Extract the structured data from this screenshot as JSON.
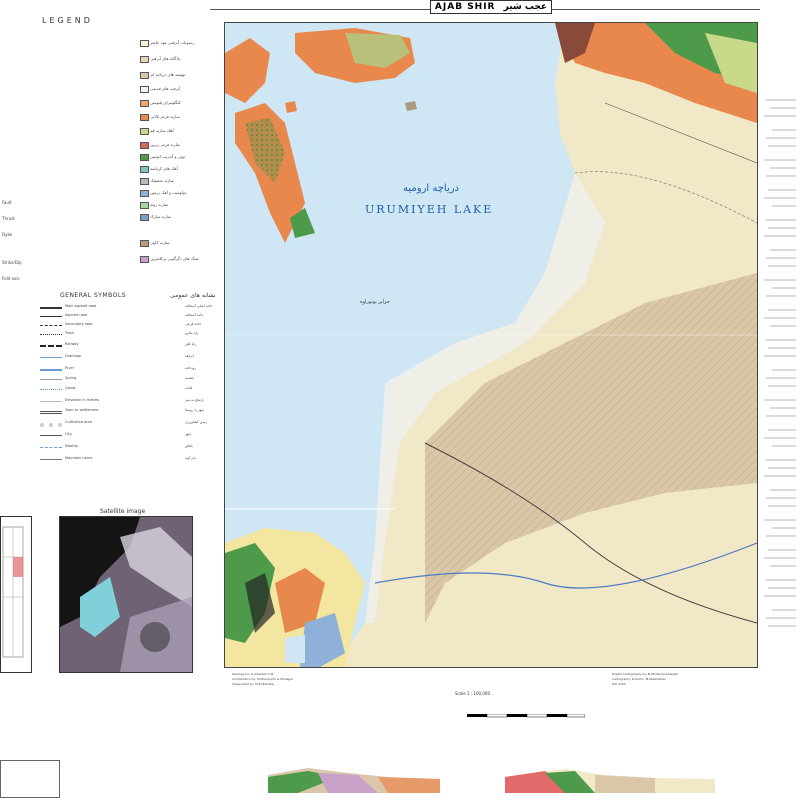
{
  "header": {
    "title": "AJAB SHIR",
    "title_fa": "عجب شیر"
  },
  "legend": {
    "title": "LEGEND",
    "items": [
      "رسوبات آبرفتی عهد حاضر",
      "پادگانه های آبرفتی",
      "نهشته های دریاچه ای",
      "آبرفت های قدیمی",
      "کنگلومرای پلیوسن",
      "سازند قرمز بالایی",
      "آهک سازند قم",
      "سازند قرمز زیرین",
      "توف و آندزیت ائوسن",
      "آهک های کرتاسه",
      "سازند شمشک",
      "دولومیت و آهک پرمین",
      "سازند روته",
      "سازند مبارک",
      "سازند لالون",
      "سنگ های دگرگونی پرکامبرین"
    ],
    "left_items": [
      "Fault",
      "Thrust",
      "Dyke",
      "Strike/Dip",
      "Fold axis"
    ]
  },
  "general_symbols": {
    "title": "GENERAL SYMBOLS",
    "title_fa": "نشانه های عمومی",
    "rows": [
      {
        "en": "Main asphalt road",
        "fa": "جاده اصلی آسفالته"
      },
      {
        "en": "Asphalt road",
        "fa": "جاده آسفالته"
      },
      {
        "en": "Secondary road",
        "fa": "جاده فرعی"
      },
      {
        "en": "Track",
        "fa": "راه مالرو"
      },
      {
        "en": "Railway",
        "fa": "راه آهن"
      },
      {
        "en": "Drainage",
        "fa": "آبراهه"
      },
      {
        "en": "River",
        "fa": "رودخانه"
      },
      {
        "en": "Spring",
        "fa": "چشمه"
      },
      {
        "en": "Qanat",
        "fa": "قنات"
      },
      {
        "en": "Elevation in metres",
        "fa": "ارتفاع به متر"
      },
      {
        "en": "Town or settlement",
        "fa": "شهر یا روستا"
      },
      {
        "en": "Cultivated area",
        "fa": "زمین کشاورزی"
      },
      {
        "en": "City",
        "fa": "شهر"
      },
      {
        "en": "Swamp",
        "fa": "باتلاق"
      },
      {
        "en": "Mountain name",
        "fa": "نام کوه"
      }
    ]
  },
  "map": {
    "lake_name_en": "URUMIYEH LAKE",
    "lake_name_fa": "دریاچه ارومیه",
    "peninsula_fa": "جزایر بوتوراوه",
    "scale": "Scale 1 : 100,000"
  },
  "satellite": {
    "title": "Satellite image"
  },
  "credits": {
    "left": [
      "Geology by: G.Alizadeh S.M.",
      "Contribution by: M.Mehrparto & Mohajjel",
      "Supervised by: M.E.Mahdavi"
    ],
    "right": [
      "Digital Cartography by: M.Mohammadzadeh",
      "Cartography Director: M.Pezeshkian",
      "GSI 2003"
    ]
  },
  "colors": {
    "lake": "#cfe6f5",
    "alluvium": "#f1e8c8",
    "terrace": "#d9c7a8",
    "red_formation": "#e9884d",
    "green_volcanic": "#4c9a4a",
    "brown_volcanic": "#8a4a3a"
  }
}
